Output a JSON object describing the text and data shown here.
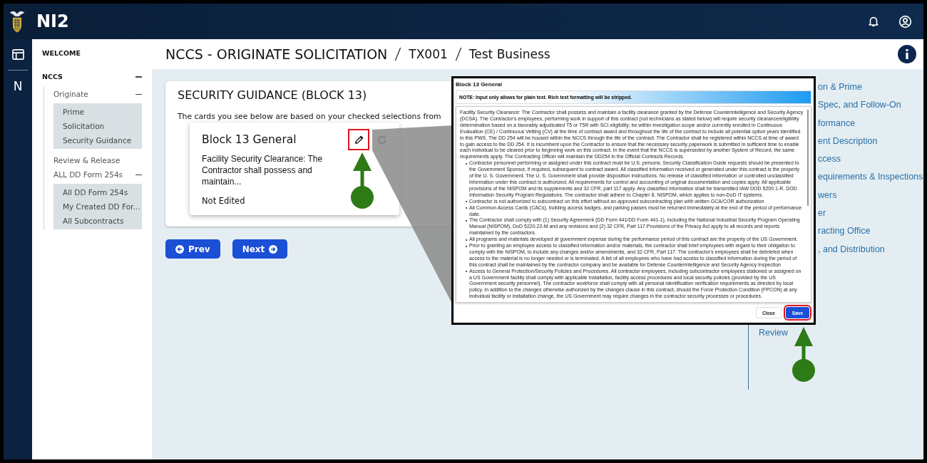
{
  "app": {
    "name": "NI2"
  },
  "rail": {
    "letter": "N"
  },
  "sidebar": {
    "welcome": "WELCOME",
    "items": [
      {
        "label": "NCCS",
        "expanded": true,
        "children": [
          {
            "label": "Originate",
            "expanded": true,
            "children": [
              {
                "label": "Prime"
              },
              {
                "label": "Solicitation"
              },
              {
                "label": "Security Guidance"
              }
            ]
          },
          {
            "label": "Review & Release"
          },
          {
            "label": "ALL DD Form 254s",
            "expanded": true,
            "children": [
              {
                "label": "All DD Form 254s"
              },
              {
                "label": "My Created DD For..."
              },
              {
                "label": "All Subcontracts"
              }
            ]
          }
        ]
      }
    ]
  },
  "breadcrumb": [
    "NCCS - ORIGINATE SOLICITATION",
    "TX001",
    "Test Business"
  ],
  "section": {
    "title": "SECURITY GUIDANCE (BLOCK 13)",
    "intro": "The cards you see below are based on your checked selections from"
  },
  "card": {
    "title": "Block 13 General",
    "excerpt": "Facility Security Clearance: The Contractor shall possess and maintain...",
    "status": "Not Edited"
  },
  "nav_buttons": [
    {
      "label": "Prev",
      "kind": "prev"
    },
    {
      "label": "Next",
      "kind": "next"
    }
  ],
  "right_links": [
    "on & Prime",
    "Spec, and Follow-On",
    "formance",
    "ent Description",
    "ccess",
    "equirements & Inspections",
    "wers",
    "er",
    "racting Office",
    ", and Distribution"
  ],
  "review_link": "Review",
  "modal": {
    "title": "Block 13 General",
    "note": "NOTE: Input only allows for plain text. Rich text formatting will be stripped.",
    "paragraph": "Facility Security Clearance: The Contractor shall possess and maintain a facility clearance granted by the Defense Counterintelligence and Security Agency (DCSA). The Contractor's employees, performing work in support of this contract (not technicians as stated below) will require security clearance/eligibility determination based on a favorably adjudicated T5 or T5R with SCI eligibility; be within investigation scope and/or currently enrolled in Continuous Evaluation (CE) / Continuous Vetting (CV) at the time of contract award and throughout the life of the contract to include all potential option years identified in this PWS. The DD 254 will be housed within the NCCS through the life of the contract. The Contractor shall be registered within NCCS at time of award to gain access to the DD 254. It is incumbent upon the Contractor to ensure that the necessary security paperwork is submitted in sufficient time to enable each individual to be cleared prior to beginning work on this contract. In the event that the NCCS is superseded by another System of Record, the same requirements apply. The Contracting Officer will maintain the DD254 in the Official Contracts Records.",
    "bullets": [
      "Contractor personnel performing or assigned under this contract must be U.S. persons. Security Classification Guide requests should be presented to the Government Sponsor, if required, subsequent to contract award. All classified information received or generated under this contract is the property of the U. S. Government. The U. S. Government shall provide disposition instructions. No release of classified information or controlled unclassified information under this contract is authorized. All requirements for control and accounting of original documentation and copies apply. All applicable provisions of the NISPOM and its supplements and 32 CFR, part 117 apply. Any classified information shall be transmitted IAW DOD 5200.1-R, DOD Information Security Program Regulations. The contractor shall adhere to Chapter 8, NISPOM, which applies to non-DoD IT systems.",
      "Contractor is not authorized to subcontract on this effort without an approved subcontracting plan with written GCA/COR authorization",
      "All Common Access Cards (CACs), building access badges, and parking passes must be returned immediately at the end of the period of performance date.",
      "The Contractor shall comply with (1) Security Agreement (DD Form 441/DD Form 441-1), including the National Industrial Security Program Operating Manual (NISPOM), DoD 5220.22-M and any revisions and (2) 32 CFR, Part 117.Provisions of the Privacy Act apply to all records and reports maintained by the contractors.",
      "All programs and materials developed at government expense during the performance period of this contract are the property of the US Government.",
      "Prior to granting an employee access to classified information and/or materials, the contractor shall brief employees with regard to their obligation to comply with the NISPOM, to include any changes and/or amendments, and 32 CFR, Part 117. The contractor's employees shall be debriefed when access to the material is no longer needed or is terminated. A list of all employees who have had access to classified information during the period of this contract shall be maintained by the contractor company and be available for Defense Counterintelligence and Security Agency Inspection",
      "Access to General Protection/Security Policies and Procedures. All contractor employees, including subcontractor employees stationed or assigned on a US Government facility shall comply with applicable installation, facility access procedures and local security policies (provided by the US Government security personnel). The contractor workforce shall comply with all personal identification verification requirements as directed by local policy. In addition to the changes otherwise authorized by the changes clause in this contract, should the Force Protection Condition (FPCON) at any individual facility or installation change, the US Government may require changes in the contractor security processes or procedures."
    ],
    "buttons": [
      {
        "label": "Close",
        "kind": "secondary"
      },
      {
        "label": "Save",
        "kind": "primary"
      }
    ]
  }
}
